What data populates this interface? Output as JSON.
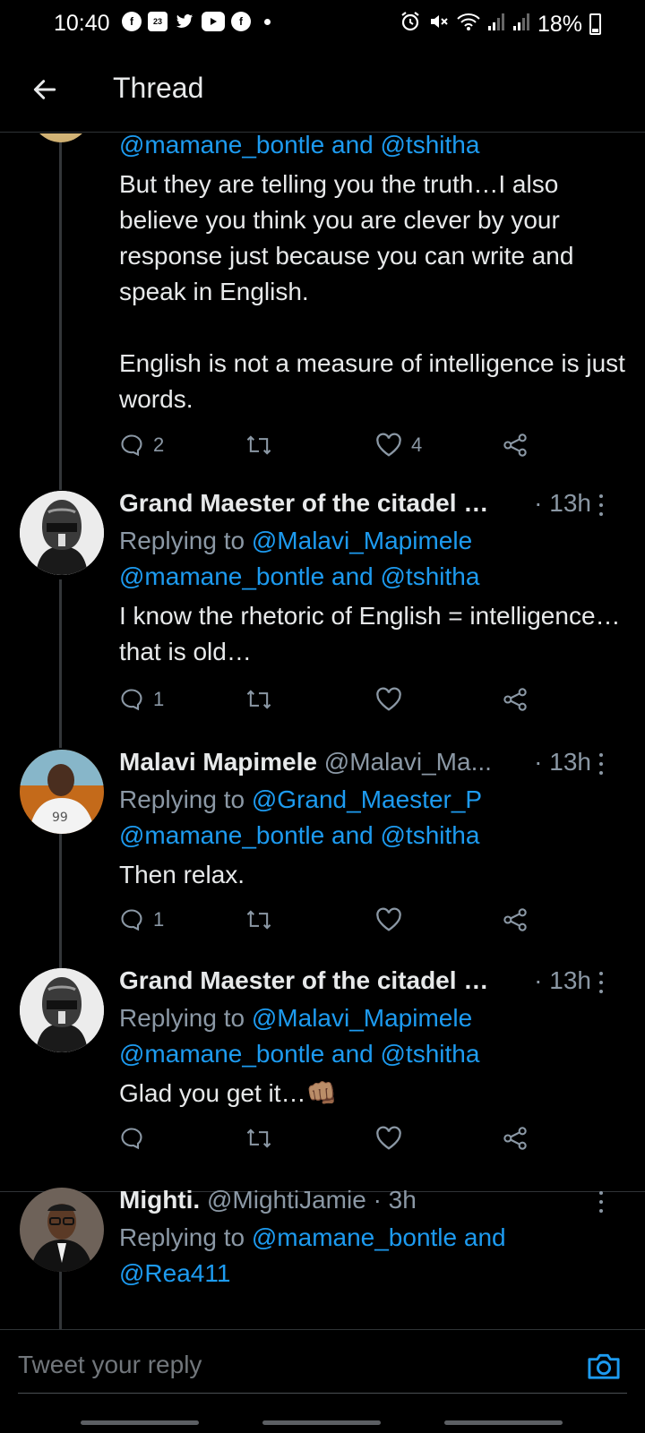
{
  "status_bar": {
    "time": "10:40",
    "battery": "18%",
    "notification_icons": [
      "facebook-icon",
      "calendar-icon",
      "twitter-icon",
      "youtube-icon",
      "facebook-icon"
    ],
    "calendar_day": "23",
    "system_icons": [
      "alarm-icon",
      "mute-icon",
      "wifi-icon",
      "signal-icon",
      "signal-icon",
      "battery-icon"
    ]
  },
  "header": {
    "title": "Thread"
  },
  "tweets": [
    {
      "mention_line": "@mamane_bontle and @tshitha",
      "text": "But they are telling you the truth…I also believe you think you are clever by your response just because you can write and speak in English.\n\nEnglish is not a measure of intelligence is just words.",
      "reply_count": "2",
      "like_count": "4"
    },
    {
      "name": "Grand Maester of the citadel …",
      "time": "· 13h",
      "replying_prefix": "Replying to",
      "replying_to": "@Malavi_Mapimele",
      "mention_line": "@mamane_bontle and @tshitha",
      "text": "I know the rhetoric of English = intelligence… that is old…",
      "reply_count": "1"
    },
    {
      "name": "Malavi Mapimele",
      "handle": "@Malavi_Ma...",
      "time": "· 13h",
      "replying_prefix": "Replying to",
      "replying_to": "@Grand_Maester_P",
      "mention_line": "@mamane_bontle and @tshitha",
      "text": "Then relax.",
      "reply_count": "1"
    },
    {
      "name": "Grand Maester of the citadel …",
      "time": "· 13h",
      "replying_prefix": "Replying to",
      "replying_to": "@Malavi_Mapimele",
      "mention_line": "@mamane_bontle and @tshitha",
      "text": "Glad you get it…👊🏽"
    },
    {
      "name": "Mighti.",
      "handle": "@MightiJamie",
      "time": "· 3h",
      "replying_prefix": "Replying to",
      "replying_to": "@mamane_bontle and",
      "replying_to_2": "@Rea411"
    }
  ],
  "reply_bar": {
    "placeholder": "Tweet your reply"
  },
  "colors": {
    "background": "#000000",
    "link": "#1d9bf0",
    "secondary": "#8b98a5",
    "text": "#e7e9ea"
  }
}
